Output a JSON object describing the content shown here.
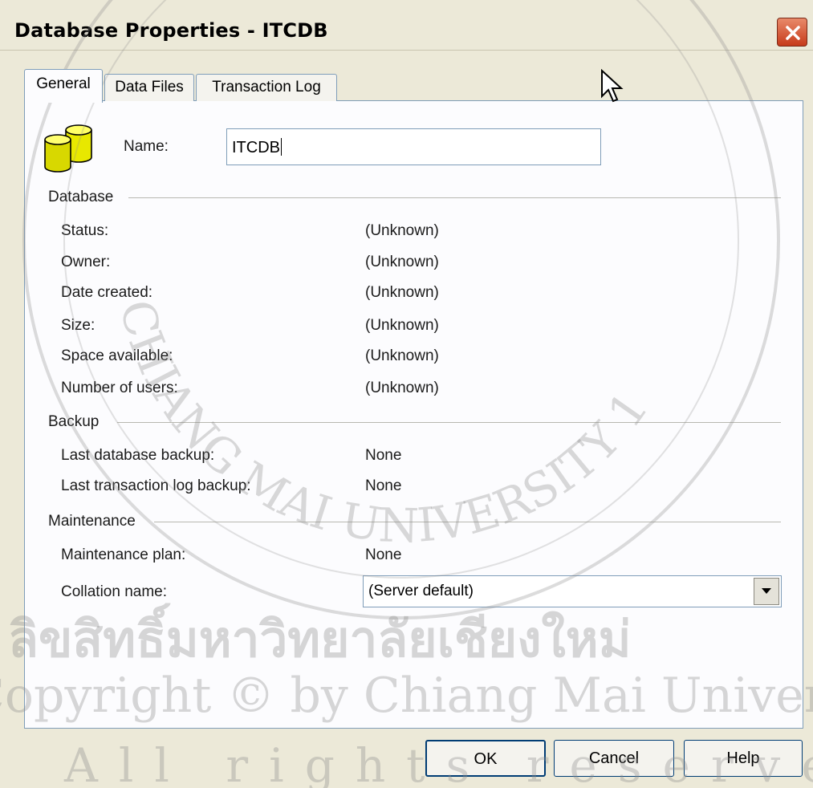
{
  "window": {
    "title": "Database Properties - ITCDB"
  },
  "tabs": [
    {
      "label": "General",
      "active": true
    },
    {
      "label": "Data Files",
      "active": false
    },
    {
      "label": "Transaction Log",
      "active": false
    }
  ],
  "general": {
    "name_label": "Name:",
    "name_value": "ITCDB",
    "database_section": "Database",
    "database_rows": [
      {
        "label": "Status:",
        "value": "(Unknown)"
      },
      {
        "label": "Owner:",
        "value": "(Unknown)"
      },
      {
        "label": "Date created:",
        "value": "(Unknown)"
      },
      {
        "label": "Size:",
        "value": "(Unknown)"
      },
      {
        "label": "Space available:",
        "value": "(Unknown)"
      },
      {
        "label": "Number of users:",
        "value": "(Unknown)"
      }
    ],
    "backup_section": "Backup",
    "backup_rows": [
      {
        "label": "Last database backup:",
        "value": "None"
      },
      {
        "label": "Last transaction log backup:",
        "value": "None"
      }
    ],
    "maintenance_section": "Maintenance",
    "maintenance_plan_label": "Maintenance plan:",
    "maintenance_plan_value": "None",
    "collation_label": "Collation name:",
    "collation_value": "(Server default)"
  },
  "buttons": {
    "ok": "OK",
    "cancel": "Cancel",
    "help": "Help"
  },
  "icons": [
    "close-icon",
    "database-icon",
    "dropdown-arrow-icon",
    "mouse-cursor-icon"
  ],
  "watermark": {
    "seal_text": "CHIANG MAI UNIVERSITY 1964",
    "thai_text": "ลิขสิทธิ์มหาวิทยาลัยเชียงใหม่",
    "copyright_text": "Copyright © by Chiang Mai University",
    "rights_text": "All rights reserved"
  }
}
